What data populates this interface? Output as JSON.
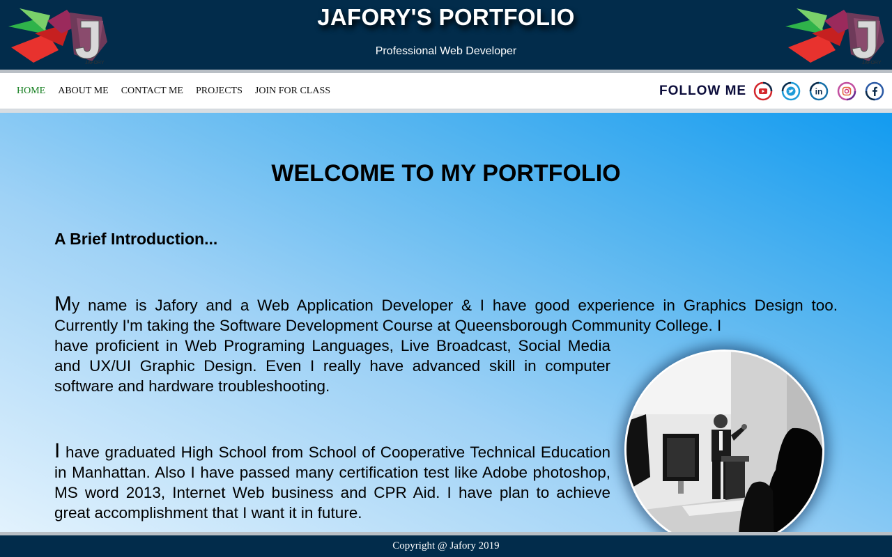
{
  "header": {
    "title": "JAFORY'S PORTFOLIO",
    "subtitle": "Professional Web Developer",
    "logo_icon": "jafory-logo-icon",
    "logo_text": "J"
  },
  "nav": {
    "items": [
      {
        "label": "HOME",
        "active": true
      },
      {
        "label": "ABOUT ME"
      },
      {
        "label": "CONTACT ME"
      },
      {
        "label": "PROJECTS"
      },
      {
        "label": "JOIN FOR CLASS"
      }
    ],
    "active_color": "#0f7b1a"
  },
  "social": {
    "label": "FOLLOW ME",
    "icons": [
      "youtube-icon",
      "twitter-icon",
      "linkedin-icon",
      "instagram-icon",
      "facebook-icon"
    ]
  },
  "main": {
    "welcome": "WELCOME TO MY PORTFOLIO",
    "intro_heading": "A Brief Introduction...",
    "para1_first": "M",
    "para1_full": "y name is Jafory and a Web Application Developer & I have good experience in Graphics Design too. Currently I'm taking the Software Development Course at Queensborough Community College. I",
    "para1_narrow": "have proficient in Web Programing Languages, Live Broadcast, Social Media and UX/UI Graphic Design. Even I really have advanced skill in computer software and hardware troubleshooting.",
    "para2_first": "I",
    "para2_rest": " have graduated High School from School of Cooperative Technical Education in Manhattan. Also I have passed many certification test like Adobe photoshop, MS word 2013, Internet Web business and CPR Aid. I have plan to achieve great accomplishment that I want it in future.",
    "photo": "profile-photo"
  },
  "footer": {
    "copyright": "Copyright @ Jafory 2019"
  },
  "colors": {
    "header_bg": "#022c4b",
    "gradient_start": "#129bf0",
    "gradient_end": "#e2f2fd",
    "follow_label": "#0b0c3a"
  }
}
